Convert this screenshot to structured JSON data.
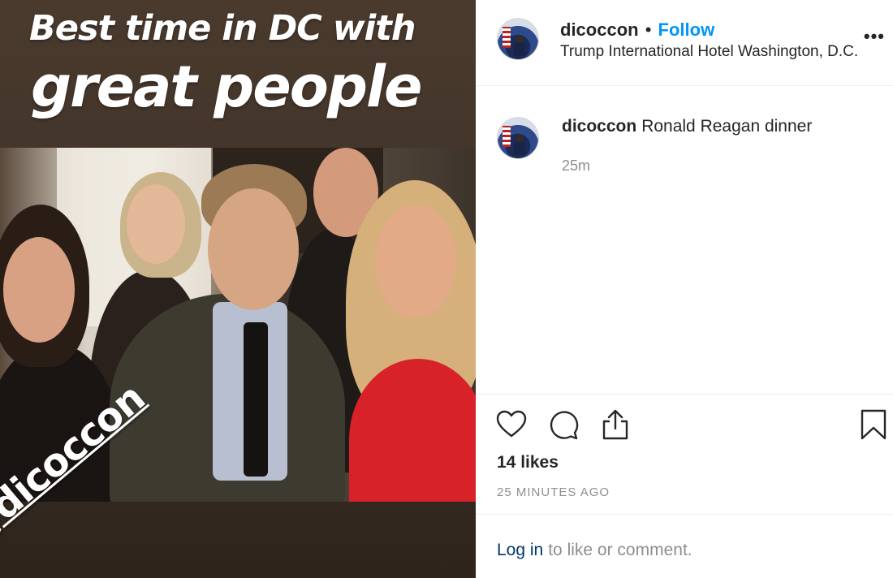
{
  "photo": {
    "caption_line1": "Best time in DC with",
    "caption_line2": "great people",
    "handle_overlay": "@dicoccon"
  },
  "post_header": {
    "username": "dicoccon",
    "separator": "•",
    "follow_label": "Follow",
    "location": "Trump International Hotel Washington, D.C.",
    "more_icon": "more-options-icon"
  },
  "comment": {
    "username": "dicoccon",
    "text": "Ronald Reagan dinner",
    "time": "25m"
  },
  "actions": {
    "icons": [
      "heart-icon",
      "comment-bubble-icon",
      "share-icon",
      "bookmark-icon"
    ],
    "likes": "14 likes",
    "posted": "25 MINUTES AGO"
  },
  "login": {
    "link": "Log in",
    "rest": "to like or comment."
  },
  "colors": {
    "follow_blue": "#0095f6",
    "login_link": "#00376b",
    "muted_gray": "#8e8e8e",
    "text_dark": "#262626"
  }
}
